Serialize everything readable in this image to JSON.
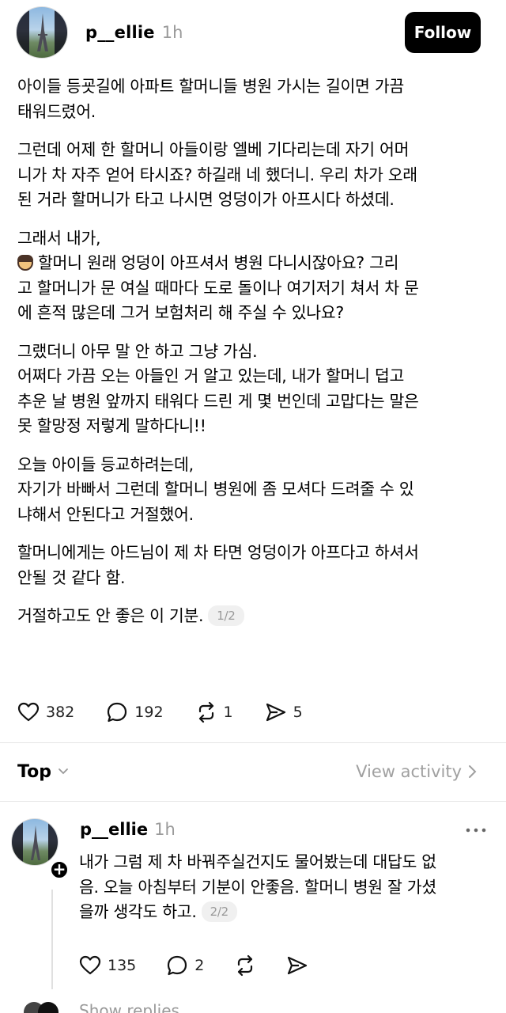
{
  "post": {
    "username": "p__ellie",
    "time": "1h",
    "follow_label": "Follow",
    "paragraphs": [
      [
        "아이들 등굣길에 아파트 할머니들 병원 가시는 길이면 가끔",
        "태워드렸어."
      ],
      [
        "그런데 어제 한 할머니 아들이랑 엘베 기다리는데 자기 어머",
        "니가 차 자주 얻어 타시죠? 하길래 네 했더니. 우리 차가 오래",
        "된 거라 할머니가 타고 나시면 엉덩이가 아프시다 하셨데."
      ],
      [
        "그래서 내가,",
        "할머니 원래 엉덩이 아프셔서 병원 다니시잖아요? 그리",
        "고 할머니가 문 여실 때마다 도로 돌이나 여기저기 쳐서 차 문",
        "에 흔적 많은데 그거 보험처리 해 주실 수 있나요?"
      ],
      [
        "그랬더니 아무 말 안 하고 그냥 가심.",
        "어쩌다 가끔 오는 아들인 거 알고 있는데, 내가 할머니 덥고",
        "추운 날 병원 앞까지 태워다 드린 게 몇 번인데 고맙다는 말은",
        "못 할망정 저렇게 말하다니!!"
      ],
      [
        "오늘 아이들 등교하려는데,",
        "자기가 바빠서 그런데 할머니 병원에 좀 모셔다 드려줄 수 있",
        "냐해서 안된다고 거절했어."
      ],
      [
        "할머니에게는 아드님이 제 차 타면 엉덩이가 아프다고 하셔서",
        "안될 것 같다 함."
      ],
      [
        "거절하고도 안 좋은 이 기분."
      ]
    ],
    "page_badge": "1/2",
    "likes": "382",
    "comments": "192",
    "reposts": "1",
    "shares": "5"
  },
  "sort": {
    "label": "Top",
    "view_activity": "View activity"
  },
  "reply": {
    "username": "p__ellie",
    "time": "1h",
    "lines": [
      "내가 그럼 제 차 바꿔주실건지도 물어봤는데 대답도 없",
      "음. 오늘 아침부터 기분이 안좋음. 할머니 병원 잘 가셨",
      "을까 생각도 하고."
    ],
    "page_badge": "2/2",
    "likes": "135",
    "comments": "2"
  },
  "show_replies": "Show replies",
  "icons": {
    "like": "heart-icon",
    "comment": "comment-bubble-icon",
    "repost": "repost-icon",
    "share": "send-icon",
    "more": "more-dots-icon",
    "chevron": "chevron-down-icon",
    "arrow": "chevron-right-icon"
  }
}
